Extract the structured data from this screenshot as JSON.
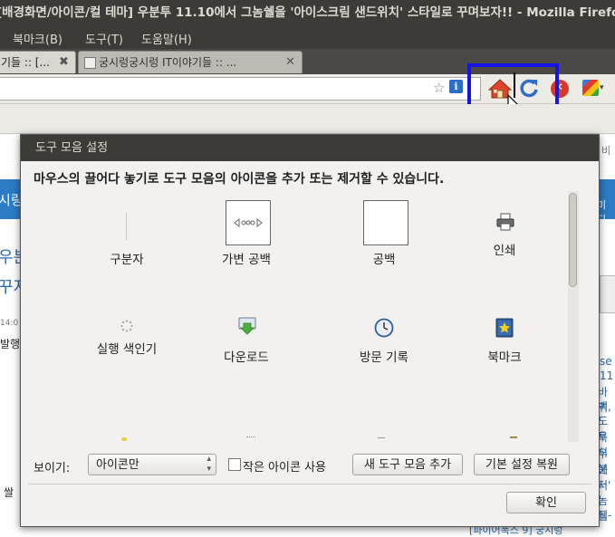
{
  "window": {
    "title": "[배경화면/아이콘/컬 테마] 우분투 11.10에서 그놈쉘을 '아이스크림 샌드위치' 스타일로 꾸며보자!! - Mozilla Firefox"
  },
  "menubar": {
    "items": [
      {
        "label": "북마크(B)"
      },
      {
        "label": "도구(T)"
      },
      {
        "label": "도움말(H)"
      }
    ]
  },
  "tabs": [
    {
      "label": "기들 :: [...",
      "close": "✖",
      "active": true
    },
    {
      "label": "궁시렁궁시렁 IT이야기들 :: ...",
      "close": "✕",
      "active": false
    }
  ],
  "navbar": {
    "icons": [
      "star-icon",
      "info-icon",
      "home-icon",
      "reload-icon",
      "stop-icon",
      "google-icon"
    ],
    "star_glyph": "☆",
    "info_glyph": "i",
    "google_arrow": "▾",
    "highlight_color": "#1515e6"
  },
  "background_page": {
    "fragments": [
      "시링",
      "우분",
      "꾸지",
      "14:0",
      "발행",
      "쌀",
      "미디",
      "비",
      "se",
      "11",
      "바귀",
      "백,",
      "도우",
      "특히",
      "우분",
      "에서",
      "터'",
      "놈쉘",
      "티-",
      "[파이어폭스 9] 궁시렁"
    ]
  },
  "dialog": {
    "title": "도구 모음 설정",
    "instruction": "마우스의 끌어다 놓기로 도구 모음의 아이콘을 추가 또는 제거할 수 있습니다.",
    "palette": [
      {
        "label": "구분자",
        "icon": "separator-icon"
      },
      {
        "label": "가변 공백",
        "icon": "flexible-space-icon"
      },
      {
        "label": "공백",
        "icon": "space-icon"
      },
      {
        "label": "인쇄",
        "icon": "print-icon"
      },
      {
        "label": "실행 색인기",
        "icon": "throbber-icon"
      },
      {
        "label": "다운로드",
        "icon": "download-icon"
      },
      {
        "label": "방문 기록",
        "icon": "history-icon"
      },
      {
        "label": "북마크",
        "icon": "bookmarks-icon"
      }
    ],
    "show_label": "보이기:",
    "show_value": "아이콘만",
    "small_icons_label": "작은 아이콘 사용",
    "add_toolbar_label": "새 도구 모음 추가",
    "restore_label": "기본 설정 복원",
    "ok_label": "확인"
  },
  "colors": {
    "titlebar_bg": "#3c3b37",
    "titlebar_text": "#dfdbd2",
    "dialog_bg": "#f2f1ef"
  }
}
